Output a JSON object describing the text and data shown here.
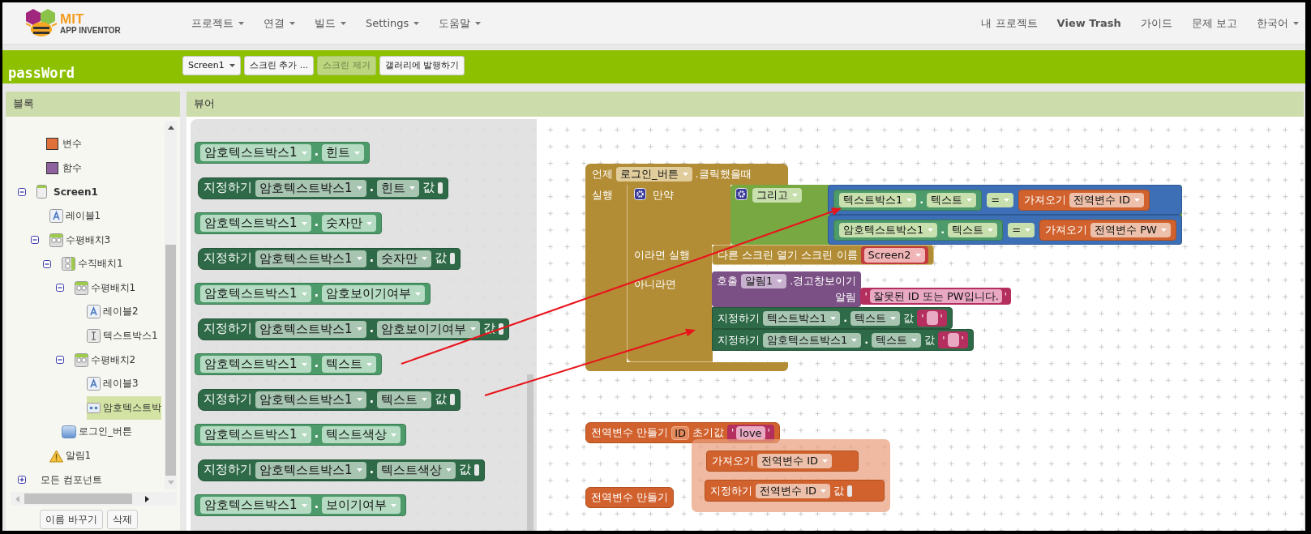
{
  "header": {
    "logo": {
      "title": "MIT",
      "subtitle": "APP INVENTOR"
    },
    "menus": [
      {
        "label": "프로젝트",
        "dropdown": true
      },
      {
        "label": "연결",
        "dropdown": true
      },
      {
        "label": "빌드",
        "dropdown": true
      },
      {
        "label": "Settings",
        "dropdown": true
      },
      {
        "label": "도움말",
        "dropdown": true
      }
    ],
    "right_links": [
      {
        "label": "내 프로젝트",
        "bold": false,
        "dropdown": false
      },
      {
        "label": "View Trash",
        "bold": true,
        "dropdown": false
      },
      {
        "label": "가이드",
        "bold": false,
        "dropdown": false
      },
      {
        "label": "문제 보고",
        "bold": false,
        "dropdown": false
      },
      {
        "label": "한국어",
        "bold": false,
        "dropdown": true
      }
    ]
  },
  "project_bar": {
    "name": "passWord",
    "buttons": [
      {
        "label": "Screen1",
        "dropdown": true,
        "disabled": false
      },
      {
        "label": "스크린 추가 ...",
        "dropdown": false,
        "disabled": false
      },
      {
        "label": "스크린 제거",
        "dropdown": false,
        "disabled": true
      },
      {
        "label": "갤러리에 발행하기",
        "dropdown": false,
        "disabled": false
      }
    ]
  },
  "blocks_panel": {
    "title": "블록",
    "categories": [
      {
        "label": "변수",
        "color": "#e0713a"
      },
      {
        "label": "함수",
        "color": "#8d629e"
      }
    ],
    "tree": [
      {
        "label": "Screen1",
        "kind": "screen",
        "expanded": true,
        "selected": false,
        "children": [
          {
            "label": "레이블1",
            "kind": "label",
            "selected": false
          },
          {
            "label": "수평배치3",
            "kind": "horizontal",
            "expanded": true,
            "selected": false,
            "children": [
              {
                "label": "수직배치1",
                "kind": "vertical",
                "expanded": true,
                "selected": false,
                "children": [
                  {
                    "label": "수평배치1",
                    "kind": "horizontal",
                    "expanded": true,
                    "selected": false,
                    "children": [
                      {
                        "label": "레이블2",
                        "kind": "label",
                        "selected": false
                      },
                      {
                        "label": "텍스트박스1",
                        "kind": "textbox",
                        "selected": false
                      }
                    ]
                  },
                  {
                    "label": "수평배치2",
                    "kind": "horizontal",
                    "expanded": true,
                    "selected": false,
                    "children": [
                      {
                        "label": "레이블3",
                        "kind": "label",
                        "selected": false
                      },
                      {
                        "label": "암호텍스트박",
                        "kind": "password",
                        "selected": true
                      }
                    ]
                  }
                ]
              },
              {
                "label": "로그인_버튼",
                "kind": "button",
                "selected": false
              }
            ]
          },
          {
            "label": "알림1",
            "kind": "notifier",
            "selected": false
          }
        ]
      }
    ],
    "all_components": {
      "label": "모든 컴포넌트",
      "expanded": false
    },
    "buttons": [
      {
        "label": "이름 바꾸기"
      },
      {
        "label": "삭제"
      }
    ]
  },
  "viewer": {
    "title": "뷰어",
    "flyout": [
      {
        "kind": "getter",
        "component": "암호텍스트박스1",
        "dot": ".",
        "property": "힌트"
      },
      {
        "kind": "setter",
        "set_label": "지정하기",
        "component": "암호텍스트박스1",
        "dot": ".",
        "property": "힌트",
        "value_label": "값"
      },
      {
        "kind": "getter",
        "component": "암호텍스트박스1",
        "dot": ".",
        "property": "숫자만"
      },
      {
        "kind": "setter",
        "set_label": "지정하기",
        "component": "암호텍스트박스1",
        "dot": ".",
        "property": "숫자만",
        "value_label": "값"
      },
      {
        "kind": "getter",
        "component": "암호텍스트박스1",
        "dot": ".",
        "property": "암호보이기여부"
      },
      {
        "kind": "setter",
        "set_label": "지정하기",
        "component": "암호텍스트박스1",
        "dot": ".",
        "property": "암호보이기여부",
        "value_label": "값"
      },
      {
        "kind": "getter",
        "component": "암호텍스트박스1",
        "dot": ".",
        "property": "텍스트"
      },
      {
        "kind": "setter",
        "set_label": "지정하기",
        "component": "암호텍스트박스1",
        "dot": ".",
        "property": "텍스트",
        "value_label": "값"
      },
      {
        "kind": "getter",
        "component": "암호텍스트박스1",
        "dot": ".",
        "property": "텍스트색상"
      },
      {
        "kind": "setter",
        "set_label": "지정하기",
        "component": "암호텍스트박스1",
        "dot": ".",
        "property": "텍스트색상",
        "value_label": "값"
      },
      {
        "kind": "getter",
        "component": "암호텍스트박스1",
        "dot": ".",
        "property": "보이기여부"
      }
    ],
    "workspace": {
      "event": {
        "when_label": "언제",
        "component": "로그인_버튼",
        "event_name": ".클릭했을때",
        "do_label": "실행",
        "if": {
          "if_label": "만약",
          "condition": {
            "op_label": "그리고",
            "operands": [
              {
                "left": {
                  "component": "텍스트박스1",
                  "dot": ".",
                  "property": "텍스트"
                },
                "operator": "=",
                "right": {
                  "get_label": "가져오기",
                  "variable": "전역변수 ID"
                }
              },
              {
                "left": {
                  "component": "암호텍스트박스1",
                  "dot": ".",
                  "property": "텍스트"
                },
                "operator": "=",
                "right": {
                  "get_label": "가져오기",
                  "variable": "전역변수 PW"
                }
              }
            ]
          },
          "then_label": "이라면 실행",
          "then": [
            {
              "kind": "open_screen",
              "label": "다른 스크린 열기 스크린 이름",
              "screen": "Screen2"
            }
          ],
          "else_label": "아니라면",
          "else": [
            {
              "kind": "call",
              "call_label": "호출",
              "component": "알림1",
              "method": ".경고창보이기",
              "arg_label": "알림",
              "value": {
                "kind": "text",
                "open": "'",
                "close": "'",
                "text": "잘못된 ID 또는 PW입니다."
              }
            },
            {
              "kind": "set",
              "set_label": "지정하기",
              "component": "텍스트박스1",
              "dot": ".",
              "property": "텍스트",
              "value_label": "값",
              "value": {
                "kind": "text",
                "open": "'",
                "close": "'"
              }
            },
            {
              "kind": "set",
              "set_label": "지정하기",
              "component": "암호텍스트박스1",
              "dot": ".",
              "property": "텍스트",
              "value_label": "값",
              "value": {
                "kind": "text",
                "open": "'",
                "close": "'"
              }
            }
          ]
        }
      },
      "globals": [
        {
          "label": "전역변수 만들기",
          "name": "ID",
          "init_label": "초기값",
          "value": {
            "kind": "text",
            "open": "'",
            "close": "'",
            "text": "love"
          }
        },
        {
          "label": "전역변수 만들기"
        }
      ],
      "drag_group": [
        {
          "kind": "get",
          "get_label": "가져오기",
          "variable": "전역변수 ID"
        },
        {
          "kind": "set",
          "set_label": "지정하기",
          "variable": "전역변수 ID",
          "value_label": "값"
        }
      ]
    }
  }
}
